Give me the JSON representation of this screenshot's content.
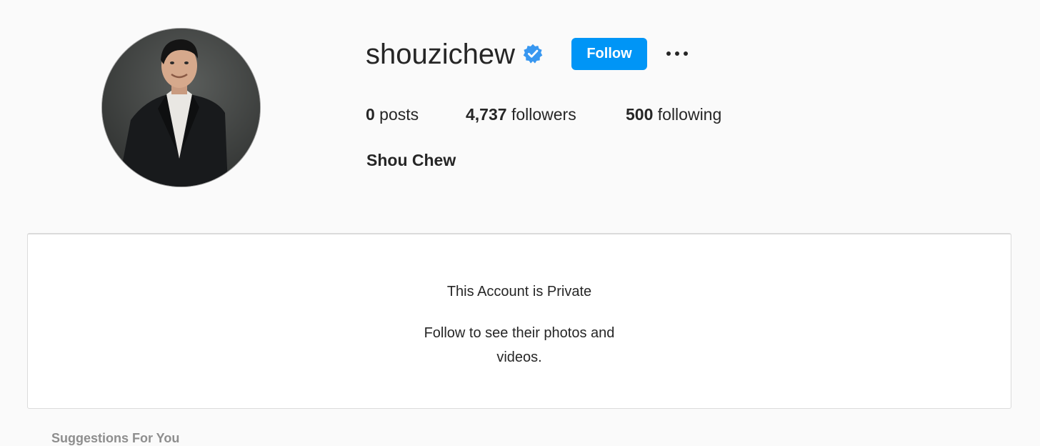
{
  "profile": {
    "username": "shouzichew",
    "verified": true,
    "full_name": "Shou Chew",
    "follow_label": "Follow",
    "more_options_icon": "more-horizontal-icon",
    "avatar_alt": "profile photo"
  },
  "stats": {
    "posts_count": "0",
    "posts_label": " posts",
    "followers_count": "4,737",
    "followers_label": " followers",
    "following_count": "500",
    "following_label": " following"
  },
  "private_notice": {
    "title": "This Account is Private",
    "subtitle": "Follow to see their photos and videos."
  },
  "suggestions": {
    "heading": "Suggestions For You"
  },
  "colors": {
    "accent": "#0095f6",
    "verified_badge": "#3897f0",
    "background": "#fafafa",
    "text": "#262626",
    "border": "#dbdbdb"
  }
}
